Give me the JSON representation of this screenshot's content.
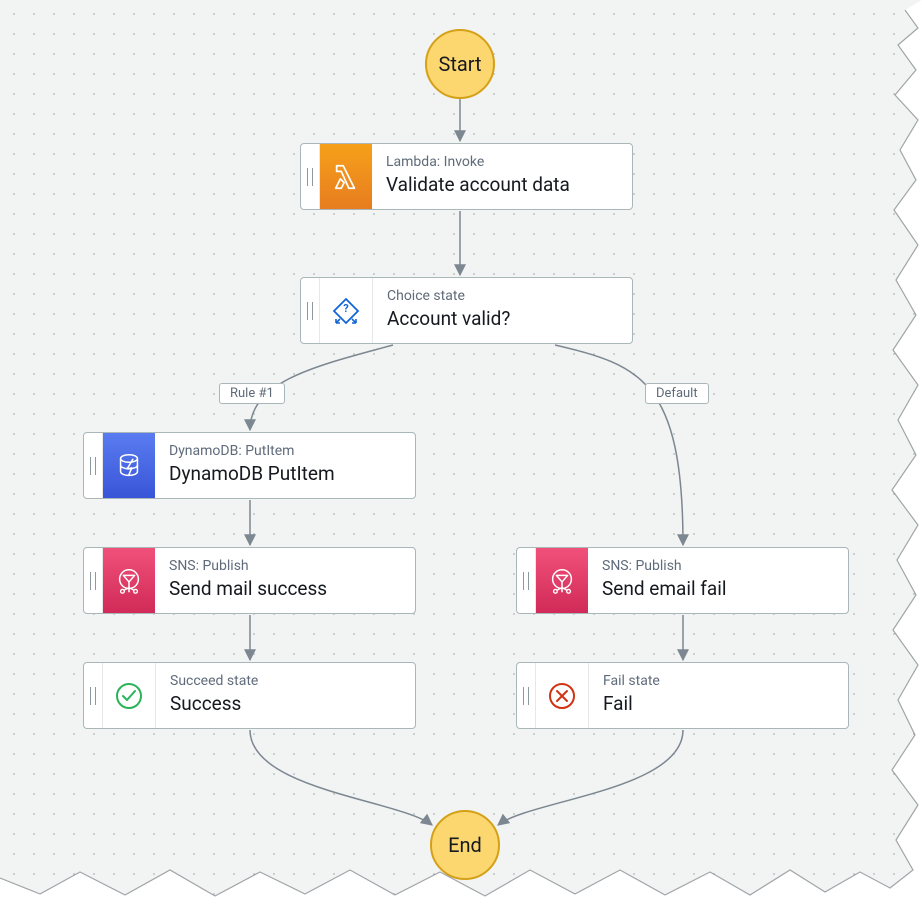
{
  "terminals": {
    "start": "Start",
    "end": "End"
  },
  "nodes": {
    "lambda": {
      "subtitle": "Lambda: Invoke",
      "title": "Validate account data"
    },
    "choice": {
      "subtitle": "Choice state",
      "title": "Account valid?"
    },
    "dynamo": {
      "subtitle": "DynamoDB: PutItem",
      "title": "DynamoDB PutItem"
    },
    "sns_success": {
      "subtitle": "SNS: Publish",
      "title": "Send mail success"
    },
    "sns_fail": {
      "subtitle": "SNS: Publish",
      "title": "Send email fail"
    },
    "succeed": {
      "subtitle": "Succeed state",
      "title": "Success"
    },
    "fail": {
      "subtitle": "Fail state",
      "title": "Fail"
    }
  },
  "edge_labels": {
    "rule1": "Rule #1",
    "default": "Default"
  },
  "colors": {
    "lambda": "#ed8b24",
    "dynamo": "#4968e4",
    "sns": "#e03e68",
    "succeed": "#2bb35a",
    "fail": "#d13212",
    "terminal": "#fcd76f",
    "line": "#7c8791"
  }
}
